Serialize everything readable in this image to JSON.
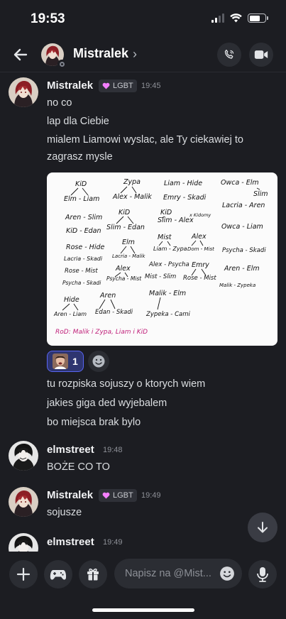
{
  "status_bar": {
    "time": "19:53"
  },
  "header": {
    "title": "Mistralek",
    "chevron": "›"
  },
  "messages": [
    {
      "author": "Mistralek",
      "role": "LGBT",
      "time": "19:45",
      "lines": [
        "no co",
        "lap dla Ciebie",
        "mialem Liamowi wyslac, ale Ty ciekawiej to zagrasz mysle"
      ],
      "after_attachment": [
        "tu rozpiska sojuszy o ktorych wiem",
        "jakies giga ded wyjebalem",
        "bo miejsca brak bylo"
      ]
    },
    {
      "author": "elmstreet",
      "time": "19:48",
      "lines": [
        "BOŻE CO TO"
      ]
    },
    {
      "author": "Mistralek",
      "role": "LGBT",
      "time": "19:49",
      "lines": [
        "sojusze"
      ]
    },
    {
      "author": "elmstreet",
      "time": "19:49",
      "lines": []
    }
  ],
  "attachment": {
    "notes": [
      "KiD",
      "Zypa",
      "Liam - Hide",
      "Owca - Elm",
      "Slim",
      "Elm - Liam",
      "Alex - Malik",
      "Emry - Skadi",
      "Lacria - Aren",
      "Aren - Slim",
      "KiD",
      "KiD",
      "Slim - Alex",
      "x Kidomy",
      "KiD - Edan",
      "Slim - Edan",
      "Owca - Liam",
      "Mist",
      "Alex",
      "Rose - Hide",
      "Elm",
      "Liam - Zypa",
      "Dom - Mist",
      "Psycha - Skadi",
      "Lacria - Skadi",
      "Lacria - Malik",
      "Rose - Mist",
      "Alex",
      "Alex - Psycha",
      "Emry",
      "Aren - Elm",
      "Psycha - Skadi",
      "Psycha - Mist",
      "Mist - Slim",
      "Rose - Mist",
      "Malik - Zypeka",
      "Hide",
      "Aren",
      "Malik - Elm",
      "Aren - Liam",
      "Edan - Skadi",
      "Zypeka - Cami"
    ],
    "footer": "RoD: Malik i Zypa, Liam i KiD"
  },
  "reactions": [
    {
      "count": "1"
    }
  ],
  "composer": {
    "placeholder": "Napisz na @Mist..."
  },
  "icons": {
    "back": "back-arrow-icon",
    "call": "phone-icon",
    "video": "video-icon",
    "plus": "plus-icon",
    "games": "gamepad-icon",
    "gift": "gift-icon",
    "emoji": "emoji-icon",
    "mic": "microphone-icon",
    "scroll": "arrow-down-icon",
    "heart": "heart-icon"
  },
  "colors": {
    "background": "#1c1d22",
    "accent": "#5865f2",
    "role_heart": "#f47fff",
    "ink": "#111111",
    "ink_pink": "#c0207a"
  }
}
